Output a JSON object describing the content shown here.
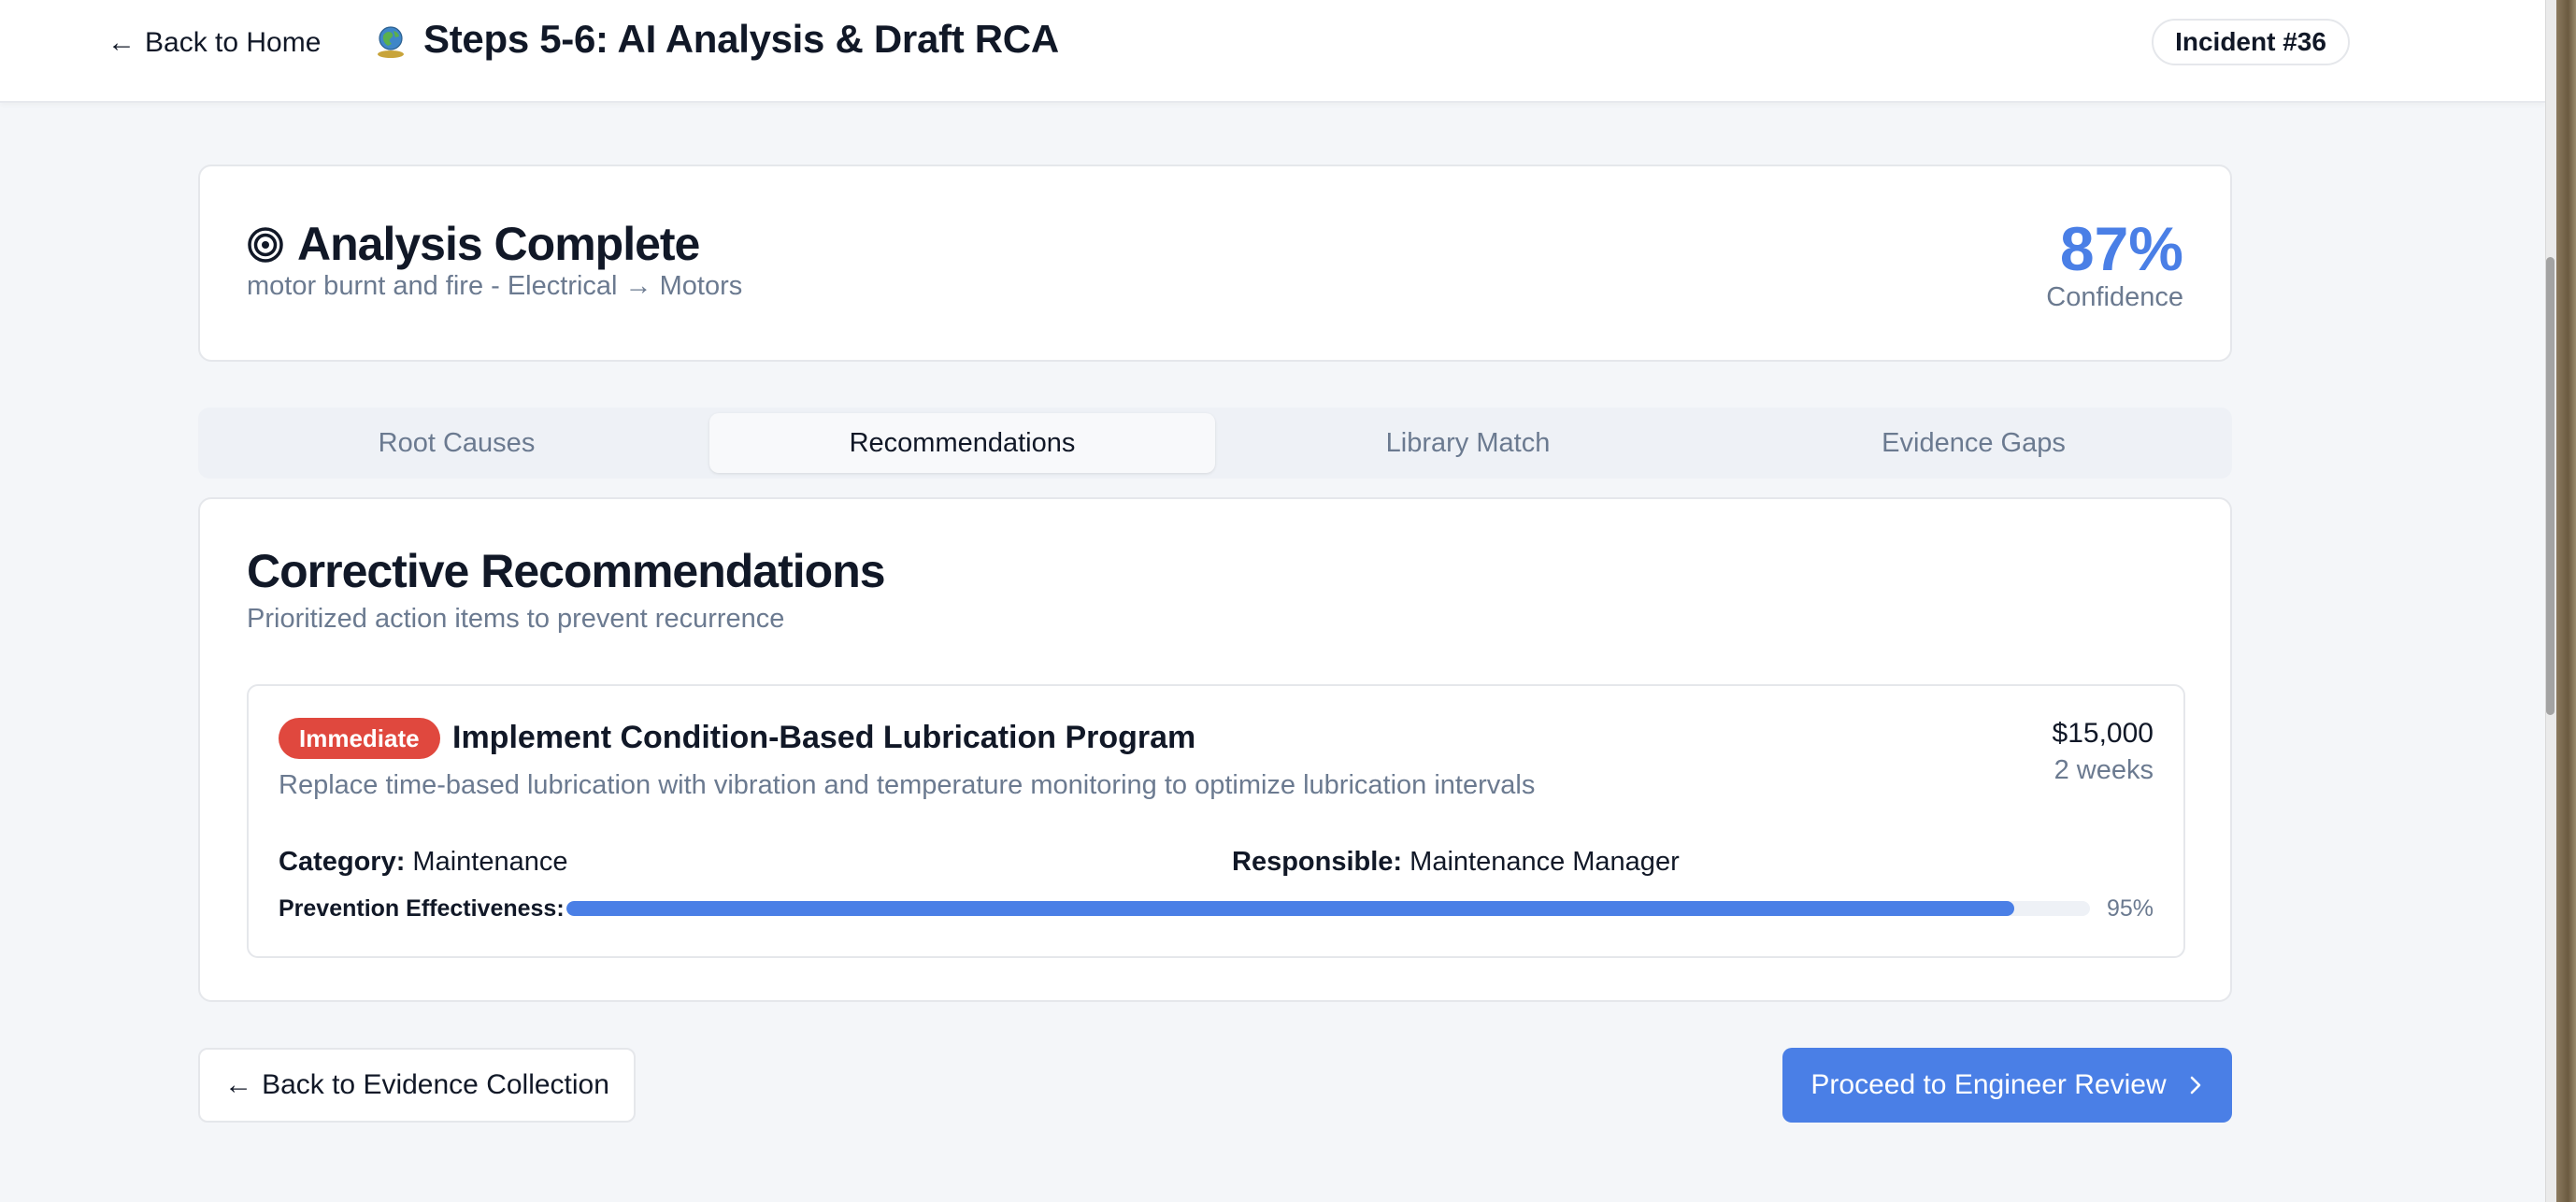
{
  "header": {
    "back_label": "Back to Home",
    "title": "Steps 5-6: AI Analysis & Draft RCA",
    "incident": "Incident #36",
    "logo_icon": "globe-logo-icon"
  },
  "summary": {
    "title": "Analysis Complete",
    "subtitle": "motor burnt and fire - Electrical → Motors",
    "confidence_value": "87%",
    "confidence_label": "Confidence",
    "accent_color": "#4a7fe6"
  },
  "tabs": [
    {
      "label": "Root Causes",
      "active": false
    },
    {
      "label": "Recommendations",
      "active": true
    },
    {
      "label": "Library Match",
      "active": false
    },
    {
      "label": "Evidence Gaps",
      "active": false
    }
  ],
  "recommendations": {
    "title": "Corrective Recommendations",
    "subtitle": "Prioritized action items to prevent recurrence",
    "items": [
      {
        "priority": "Immediate",
        "priority_color": "#e0483e",
        "title": "Implement Condition-Based Lubrication Program",
        "description": "Replace time-based lubrication with vibration and temperature monitoring to optimize lubrication intervals",
        "cost": "$15,000",
        "timeline": "2 weeks",
        "category_label": "Category:",
        "category": "Maintenance",
        "responsible_label": "Responsible:",
        "responsible": "Maintenance Manager",
        "effectiveness_label": "Prevention Effectiveness:",
        "effectiveness_text": "95%",
        "effectiveness_value": 0.95
      }
    ]
  },
  "footer": {
    "back_label": "Back to Evidence Collection",
    "proceed_label": "Proceed to Engineer Review"
  }
}
